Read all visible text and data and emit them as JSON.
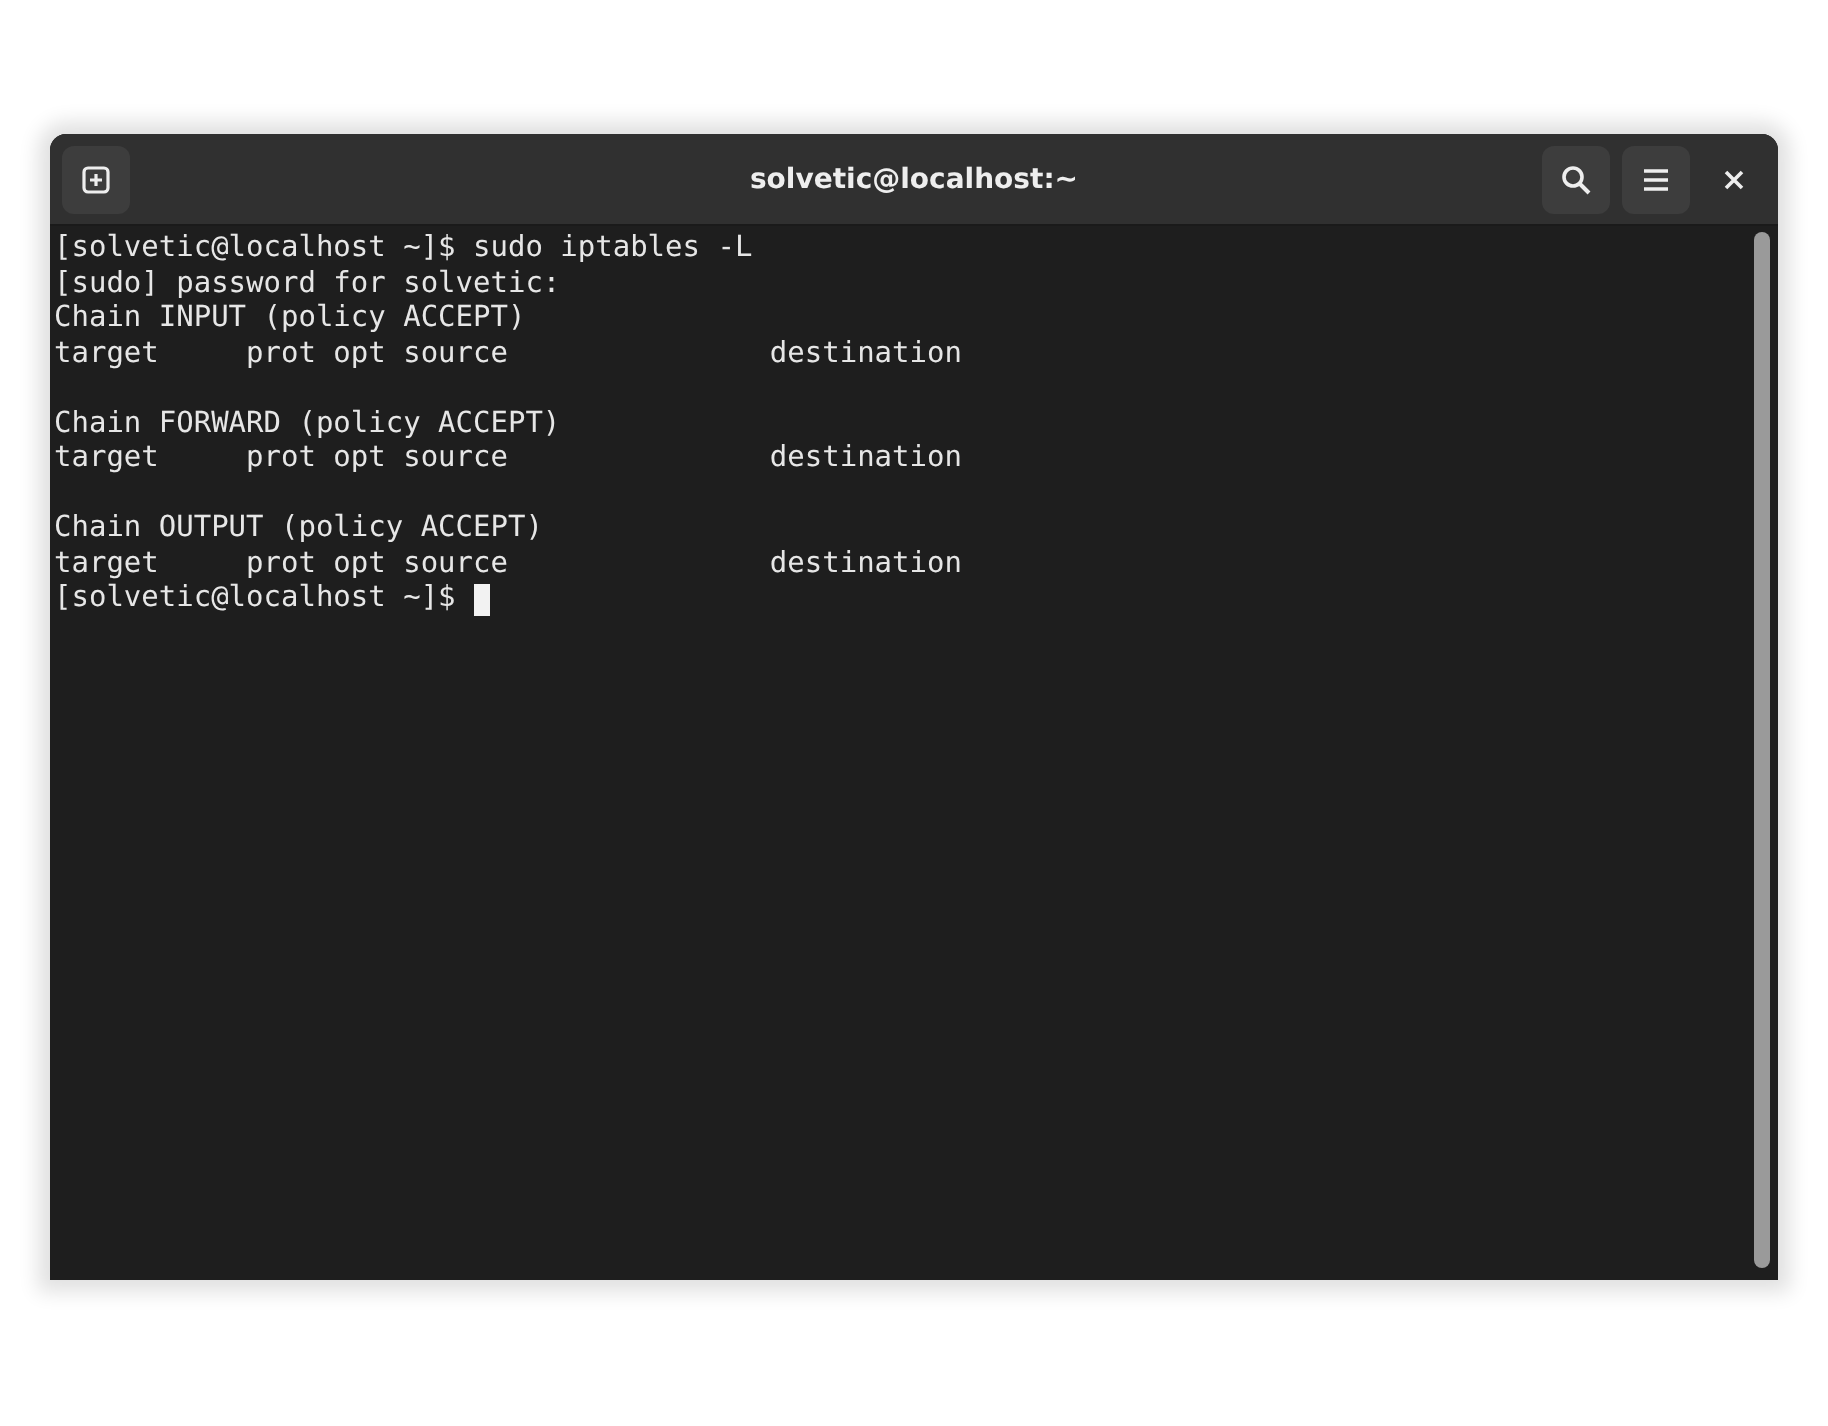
{
  "window": {
    "title": "solvetic@localhost:~"
  },
  "terminal": {
    "blocks": [
      [
        {
          "text": "[solvetic@localhost ~]$ sudo iptables -L",
          "cursor": false
        },
        {
          "text": "[sudo] password for solvetic:",
          "cursor": false
        },
        {
          "text": "Chain INPUT (policy ACCEPT)",
          "cursor": false
        },
        {
          "text": "target     prot opt source               destination",
          "cursor": false
        }
      ],
      [
        {
          "text": "Chain FORWARD (policy ACCEPT)",
          "cursor": false
        },
        {
          "text": "target     prot opt source               destination",
          "cursor": false
        }
      ],
      [
        {
          "text": "Chain OUTPUT (policy ACCEPT)",
          "cursor": false
        },
        {
          "text": "target     prot opt source               destination",
          "cursor": false
        },
        {
          "text": "[solvetic@localhost ~]$ ",
          "cursor": true
        }
      ]
    ]
  }
}
